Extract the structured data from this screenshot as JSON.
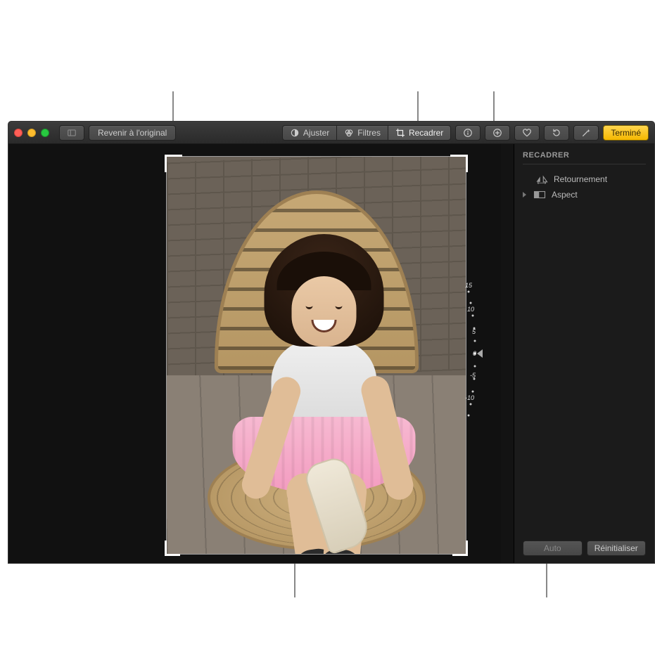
{
  "toolbar": {
    "revert_label": "Revenir à l'original",
    "adjust_label": "Ajuster",
    "filters_label": "Filtres",
    "crop_label": "Recadrer",
    "done_label": "Terminé"
  },
  "sidebar": {
    "title": "RECADRER",
    "flip_label": "Retournement",
    "aspect_label": "Aspect",
    "auto_label": "Auto",
    "reset_label": "Réinitialiser"
  },
  "dial": {
    "ticks": [
      "15",
      "10",
      "5",
      "0",
      "-5",
      "-10"
    ]
  }
}
